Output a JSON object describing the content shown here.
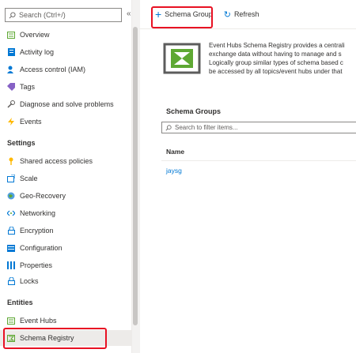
{
  "sidebar": {
    "search_placeholder": "Search (Ctrl+/)",
    "collapse_glyph": "«",
    "items_top": [
      {
        "label": "Overview",
        "icon": "overview-icon"
      },
      {
        "label": "Activity log",
        "icon": "activity-log-icon"
      },
      {
        "label": "Access control (IAM)",
        "icon": "access-control-icon"
      },
      {
        "label": "Tags",
        "icon": "tag-icon"
      },
      {
        "label": "Diagnose and solve problems",
        "icon": "wrench-icon"
      },
      {
        "label": "Events",
        "icon": "lightning-icon"
      }
    ],
    "settings_heading": "Settings",
    "items_settings": [
      {
        "label": "Shared access policies",
        "icon": "key-icon"
      },
      {
        "label": "Scale",
        "icon": "scale-icon"
      },
      {
        "label": "Geo-Recovery",
        "icon": "globe-icon"
      },
      {
        "label": "Networking",
        "icon": "network-icon"
      },
      {
        "label": "Encryption",
        "icon": "lock-icon"
      },
      {
        "label": "Configuration",
        "icon": "configuration-icon"
      },
      {
        "label": "Properties",
        "icon": "properties-icon"
      },
      {
        "label": "Locks",
        "icon": "lock-icon"
      }
    ],
    "entities_heading": "Entities",
    "items_entities": [
      {
        "label": "Event Hubs",
        "icon": "event-hubs-icon"
      },
      {
        "label": "Schema Registry",
        "icon": "schema-registry-icon"
      }
    ]
  },
  "toolbar": {
    "add_label": "Schema Group",
    "refresh_label": "Refresh"
  },
  "main": {
    "description_lines": [
      "Event Hubs Schema Registry provides a centrali",
      "exchange data without having to manage and s",
      "Logically group similar types of schema based c",
      "be accessed by all topics/event hubs under that"
    ],
    "groups_title": "Schema Groups",
    "filter_placeholder": "Search to filter items...",
    "column_name": "Name",
    "rows": [
      "jaysg"
    ]
  },
  "colors": {
    "accent": "#0078d4",
    "highlight_box": "#e81123",
    "selected_bg": "#edebe9",
    "hero_green": "#5ea833"
  }
}
